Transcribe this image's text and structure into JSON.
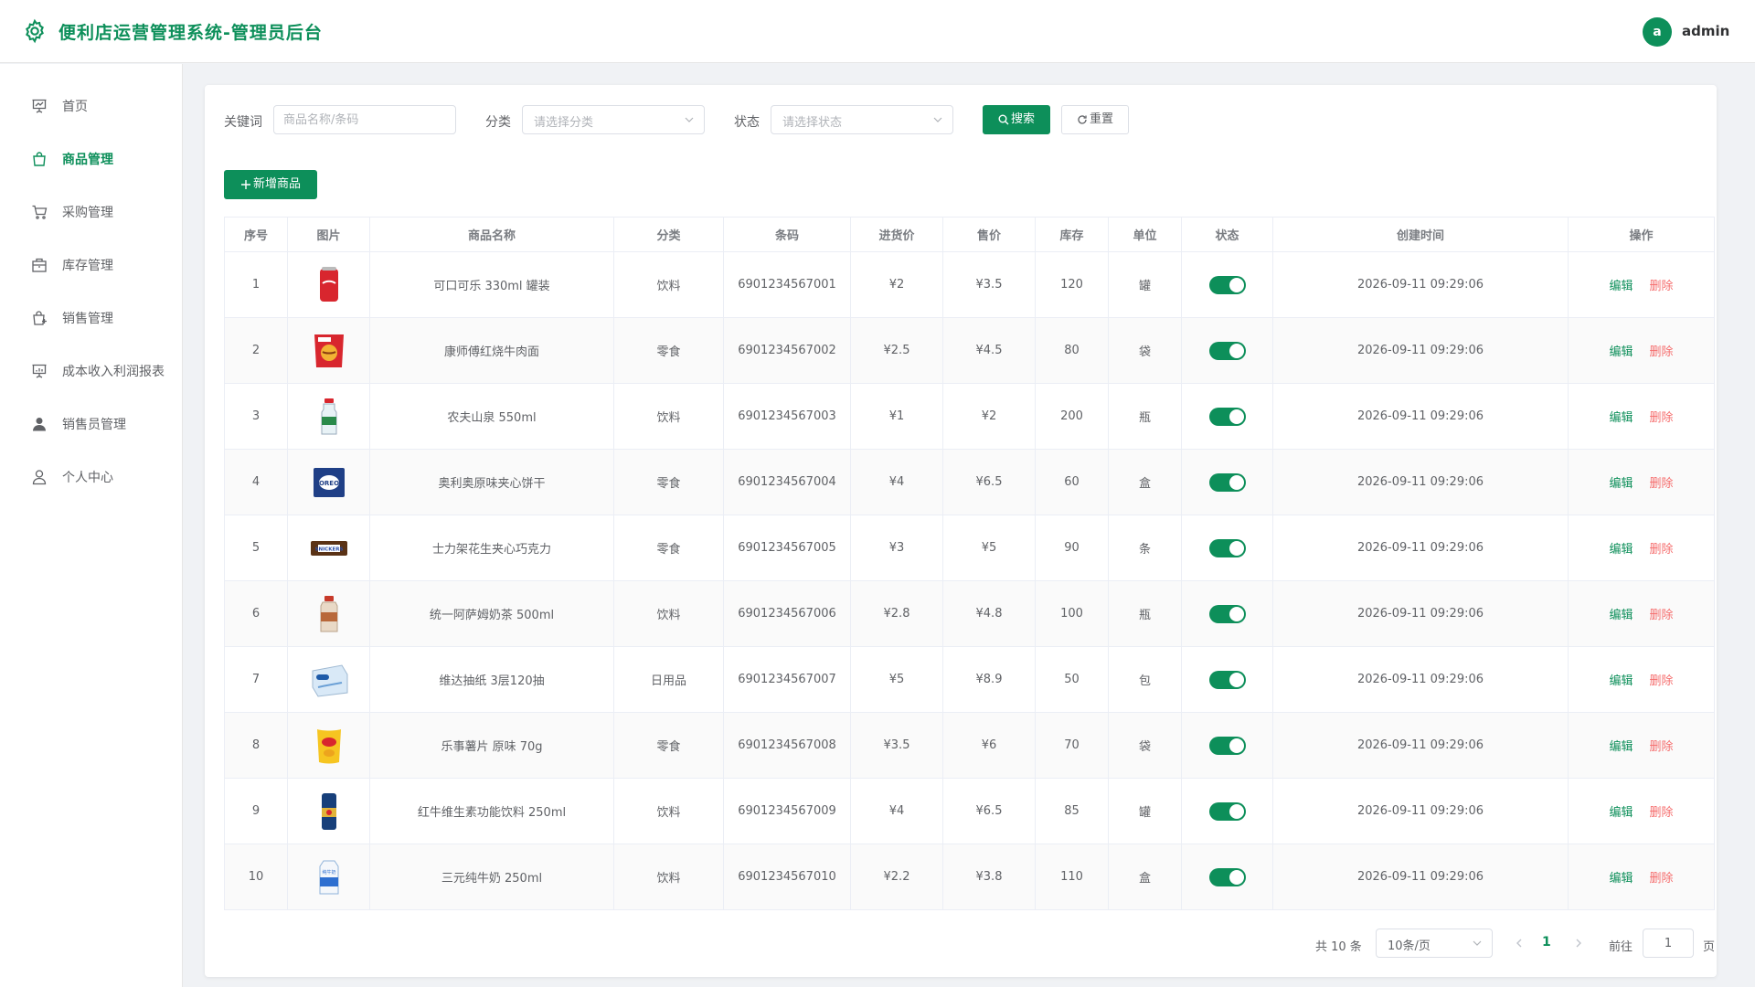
{
  "header": {
    "title": "便利店运营管理系统-管理员后台",
    "avatar_letter": "a",
    "user": "admin"
  },
  "sidebar": {
    "items": [
      {
        "label": "首页",
        "icon": "presentation-icon",
        "active": false
      },
      {
        "label": "商品管理",
        "icon": "shopping-bag-icon",
        "active": true
      },
      {
        "label": "采购管理",
        "icon": "cart-icon",
        "active": false
      },
      {
        "label": "库存管理",
        "icon": "box-icon",
        "active": false
      },
      {
        "label": "销售管理",
        "icon": "shopping-bag-plus-icon",
        "active": false
      },
      {
        "label": "成本收入利润报表",
        "icon": "report-icon",
        "active": false
      },
      {
        "label": "销售员管理",
        "icon": "user-filled-icon",
        "active": false
      },
      {
        "label": "个人中心",
        "icon": "user-icon",
        "active": false
      }
    ]
  },
  "filters": {
    "keyword_label": "关键词",
    "keyword_placeholder": "商品名称/条码",
    "keyword_value": "",
    "category_label": "分类",
    "category_placeholder": "请选择分类",
    "status_label": "状态",
    "status_placeholder": "请选择状态",
    "search_label": "搜索",
    "reset_label": "重置"
  },
  "add_button_label": "新增商品",
  "table": {
    "columns": [
      "序号",
      "图片",
      "商品名称",
      "分类",
      "条码",
      "进货价",
      "售价",
      "库存",
      "单位",
      "状态",
      "创建时间",
      "操作"
    ],
    "edit_label": "编辑",
    "delete_label": "删除",
    "rows": [
      {
        "no": "1",
        "thumb": "cola-can",
        "name": "可口可乐 330ml 罐装",
        "category": "饮料",
        "barcode": "6901234567001",
        "cost": "¥2",
        "price": "¥3.5",
        "stock": "120",
        "unit": "罐",
        "status": true,
        "created": "2026-09-11 09:29:06"
      },
      {
        "no": "2",
        "thumb": "noodle-bag",
        "name": "康师傅红烧牛肉面",
        "category": "零食",
        "barcode": "6901234567002",
        "cost": "¥2.5",
        "price": "¥4.5",
        "stock": "80",
        "unit": "袋",
        "status": true,
        "created": "2026-09-11 09:29:06"
      },
      {
        "no": "3",
        "thumb": "water-bottle",
        "name": "农夫山泉 550ml",
        "category": "饮料",
        "barcode": "6901234567003",
        "cost": "¥1",
        "price": "¥2",
        "stock": "200",
        "unit": "瓶",
        "status": true,
        "created": "2026-09-11 09:29:06"
      },
      {
        "no": "4",
        "thumb": "oreo-box",
        "name": "奥利奥原味夹心饼干",
        "category": "零食",
        "barcode": "6901234567004",
        "cost": "¥4",
        "price": "¥6.5",
        "stock": "60",
        "unit": "盒",
        "status": true,
        "created": "2026-09-11 09:29:06"
      },
      {
        "no": "5",
        "thumb": "chocolate-bar",
        "name": "士力架花生夹心巧克力",
        "category": "零食",
        "barcode": "6901234567005",
        "cost": "¥3",
        "price": "¥5",
        "stock": "90",
        "unit": "条",
        "status": true,
        "created": "2026-09-11 09:29:06"
      },
      {
        "no": "6",
        "thumb": "milk-tea-bottle",
        "name": "统一阿萨姆奶茶 500ml",
        "category": "饮料",
        "barcode": "6901234567006",
        "cost": "¥2.8",
        "price": "¥4.8",
        "stock": "100",
        "unit": "瓶",
        "status": true,
        "created": "2026-09-11 09:29:06"
      },
      {
        "no": "7",
        "thumb": "tissue-pack",
        "name": "维达抽纸 3层120抽",
        "category": "日用品",
        "barcode": "6901234567007",
        "cost": "¥5",
        "price": "¥8.9",
        "stock": "50",
        "unit": "包",
        "status": true,
        "created": "2026-09-11 09:29:06"
      },
      {
        "no": "8",
        "thumb": "chips-bag",
        "name": "乐事薯片 原味 70g",
        "category": "零食",
        "barcode": "6901234567008",
        "cost": "¥3.5",
        "price": "¥6",
        "stock": "70",
        "unit": "袋",
        "status": true,
        "created": "2026-09-11 09:29:06"
      },
      {
        "no": "9",
        "thumb": "energy-can",
        "name": "红牛维生素功能饮料 250ml",
        "category": "饮料",
        "barcode": "6901234567009",
        "cost": "¥4",
        "price": "¥6.5",
        "stock": "85",
        "unit": "罐",
        "status": true,
        "created": "2026-09-11 09:29:06"
      },
      {
        "no": "10",
        "thumb": "milk-carton",
        "name": "三元纯牛奶 250ml",
        "category": "饮料",
        "barcode": "6901234567010",
        "cost": "¥2.2",
        "price": "¥3.8",
        "stock": "110",
        "unit": "盒",
        "status": true,
        "created": "2026-09-11 09:29:06"
      }
    ]
  },
  "pagination": {
    "total": "共 10 条",
    "page_size": "10条/页",
    "current_page": "1",
    "goto_label": "前往",
    "goto_value": "1",
    "page_suffix": "页"
  },
  "colors": {
    "accent": "#0d8f5a",
    "danger": "#f56c6c"
  }
}
